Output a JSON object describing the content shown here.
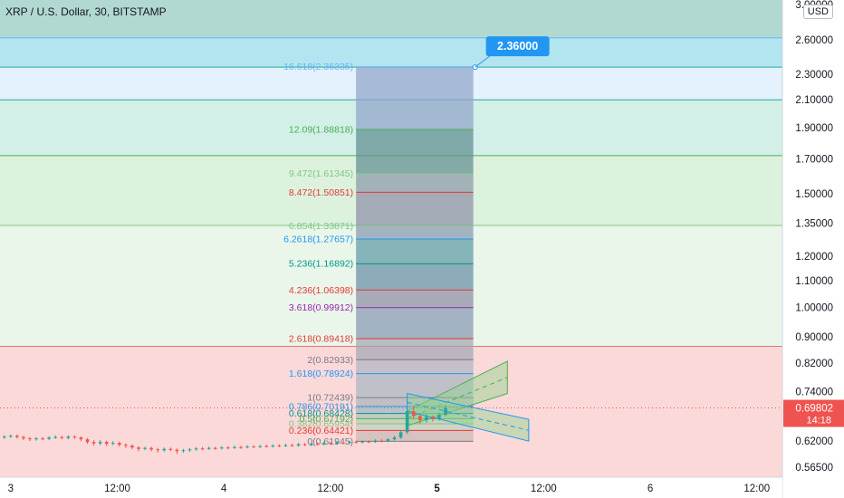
{
  "header": {
    "title": "XRP / U.S. Dollar, 30, BITSTAMP",
    "currency_badge": "USD"
  },
  "chart_data": {
    "type": "candlestick",
    "price_axis": {
      "scale": "log",
      "range": [
        0.545,
        3.0
      ],
      "ticks": [
        "2.60000",
        "2.30000",
        "2.10000",
        "1.90000",
        "1.70000",
        "1.50000",
        "1.35000",
        "1.20000",
        "1.10000",
        "1.00000",
        "0.90000",
        "0.82000",
        "0.74000",
        "0.62000",
        "0.56500"
      ],
      "top_tick": "3.00000"
    },
    "time_axis": {
      "ticks": [
        {
          "label": "3",
          "day": 3.0
        },
        {
          "label": "12:00",
          "day": 3.5
        },
        {
          "label": "4",
          "day": 4.0
        },
        {
          "label": "12:00",
          "day": 4.5
        },
        {
          "label": "5",
          "day": 5.0
        },
        {
          "label": "12:00",
          "day": 5.5
        },
        {
          "label": "6",
          "day": 6.0
        },
        {
          "label": "12:00",
          "day": 6.5
        }
      ],
      "range_days": [
        2.95,
        6.62
      ]
    },
    "current_price": {
      "value": "0.69802",
      "countdown": "14:18",
      "price": 0.69802
    },
    "target_callout": {
      "label": "2.36000",
      "price": 2.36
    },
    "fib_extension": {
      "start_day": 4.62,
      "end_day": 5.17,
      "levels": [
        {
          "ratio": "16.618",
          "price": 2.36335,
          "label": "16.618(2.36335)",
          "color": "#64b5f6"
        },
        {
          "ratio": "12.09",
          "price": 1.88818,
          "label": "12.09(1.88818)",
          "color": "#4caf50"
        },
        {
          "ratio": "9.472",
          "price": 1.61345,
          "label": "9.472(1.61345)",
          "color": "#81c784"
        },
        {
          "ratio": "8.472",
          "price": 1.50851,
          "label": "8.472(1.50851)",
          "color": "#e53935"
        },
        {
          "ratio": "6.854",
          "price": 1.33871,
          "label": "6.854(1.33871)",
          "color": "#81c784"
        },
        {
          "ratio": "6.2618",
          "price": 1.27657,
          "label": "6.2618(1.27657)",
          "color": "#2196f3"
        },
        {
          "ratio": "5.236",
          "price": 1.16892,
          "label": "5.236(1.16892)",
          "color": "#009688"
        },
        {
          "ratio": "4.236",
          "price": 1.06398,
          "label": "4.236(1.06398)",
          "color": "#e53935"
        },
        {
          "ratio": "3.618",
          "price": 0.99912,
          "label": "3.618(0.99912)",
          "color": "#9c27b0"
        },
        {
          "ratio": "2.618",
          "price": 0.89418,
          "label": "2.618(0.89418)",
          "color": "#e53935"
        },
        {
          "ratio": "2",
          "price": 0.82933,
          "label": "2(0.82933)",
          "color": "#787b86"
        },
        {
          "ratio": "1.618",
          "price": 0.78924,
          "label": "1.618(0.78924)",
          "color": "#2196f3"
        },
        {
          "ratio": "1",
          "price": 0.72439,
          "label": "1(0.72439)",
          "color": "#787b86"
        },
        {
          "ratio": "0.786",
          "price": 0.70191,
          "label": "0.786(0.70191)",
          "color": "#2196f3"
        },
        {
          "ratio": "0.618",
          "price": 0.68428,
          "label": "0.618(0.68428)",
          "color": "#009688"
        },
        {
          "ratio": "0.5",
          "price": 0.67192,
          "label": "0.5(0.67192)",
          "color": "#4caf50"
        },
        {
          "ratio": "0.382",
          "price": 0.65954,
          "label": "0.382(0.65954)",
          "color": "#81c784"
        },
        {
          "ratio": "0.236",
          "price": 0.64421,
          "label": "0.236(0.64421)",
          "color": "#e53935"
        },
        {
          "ratio": "0",
          "price": 0.61945,
          "label": "0(0.61945)",
          "color": "#787b86"
        }
      ]
    },
    "zones": [
      {
        "from": 2.62,
        "to": 3.0,
        "color": "#b2d8d2"
      },
      {
        "from": 2.36,
        "to": 2.62,
        "color": "#b3e5f0"
      },
      {
        "from": 2.1,
        "to": 2.36,
        "color": "#e3f2fd"
      },
      {
        "from": 1.72,
        "to": 2.1,
        "color": "#d2f0e8"
      },
      {
        "from": 1.34,
        "to": 1.72,
        "color": "#ddf2dd"
      },
      {
        "from": 0.87,
        "to": 1.34,
        "color": "#eaf6ea"
      },
      {
        "from": 0.545,
        "to": 0.87,
        "color": "#fbd9d9"
      }
    ],
    "zone_lines": [
      {
        "price": 2.62,
        "color": "#64b5f6"
      },
      {
        "price": 2.36,
        "color": "#26a69a"
      },
      {
        "price": 2.1,
        "color": "#26a69a"
      },
      {
        "price": 1.72,
        "color": "#4caf50"
      },
      {
        "price": 1.34,
        "color": "#81c784"
      },
      {
        "price": 0.87,
        "color": "#e57373"
      }
    ],
    "channels": [
      {
        "from_day": 4.86,
        "to_day": 5.33,
        "lower": [
          0.655,
          0.735
        ],
        "upper": [
          0.69,
          0.825
        ],
        "color": "#4caf50"
      },
      {
        "from_day": 4.86,
        "to_day": 5.43,
        "lower": [
          0.69,
          0.62
        ],
        "upper": [
          0.735,
          0.67
        ],
        "color": "#2196f3"
      }
    ],
    "series": [
      {
        "day": 2.97,
        "open": 0.628,
        "close": 0.63,
        "high": 0.633,
        "low": 0.625
      },
      {
        "day": 3.0,
        "open": 0.63,
        "close": 0.632,
        "high": 0.635,
        "low": 0.627
      },
      {
        "day": 3.03,
        "open": 0.632,
        "close": 0.629,
        "high": 0.635,
        "low": 0.626
      },
      {
        "day": 3.06,
        "open": 0.629,
        "close": 0.626,
        "high": 0.632,
        "low": 0.622
      },
      {
        "day": 3.09,
        "open": 0.626,
        "close": 0.624,
        "high": 0.629,
        "low": 0.62
      },
      {
        "day": 3.12,
        "open": 0.624,
        "close": 0.626,
        "high": 0.629,
        "low": 0.621
      },
      {
        "day": 3.15,
        "open": 0.626,
        "close": 0.625,
        "high": 0.629,
        "low": 0.622
      },
      {
        "day": 3.18,
        "open": 0.625,
        "close": 0.628,
        "high": 0.631,
        "low": 0.622
      },
      {
        "day": 3.21,
        "open": 0.628,
        "close": 0.629,
        "high": 0.633,
        "low": 0.625
      },
      {
        "day": 3.24,
        "open": 0.629,
        "close": 0.627,
        "high": 0.632,
        "low": 0.624
      },
      {
        "day": 3.27,
        "open": 0.627,
        "close": 0.63,
        "high": 0.633,
        "low": 0.624
      },
      {
        "day": 3.3,
        "open": 0.63,
        "close": 0.628,
        "high": 0.633,
        "low": 0.625
      },
      {
        "day": 3.33,
        "open": 0.628,
        "close": 0.624,
        "high": 0.631,
        "low": 0.62
      },
      {
        "day": 3.36,
        "open": 0.624,
        "close": 0.618,
        "high": 0.627,
        "low": 0.614
      },
      {
        "day": 3.39,
        "open": 0.618,
        "close": 0.615,
        "high": 0.622,
        "low": 0.61
      },
      {
        "day": 3.42,
        "open": 0.615,
        "close": 0.618,
        "high": 0.622,
        "low": 0.611
      },
      {
        "day": 3.45,
        "open": 0.618,
        "close": 0.614,
        "high": 0.621,
        "low": 0.609
      },
      {
        "day": 3.48,
        "open": 0.614,
        "close": 0.616,
        "high": 0.62,
        "low": 0.611
      },
      {
        "day": 3.51,
        "open": 0.616,
        "close": 0.612,
        "high": 0.619,
        "low": 0.608
      },
      {
        "day": 3.54,
        "open": 0.612,
        "close": 0.61,
        "high": 0.615,
        "low": 0.605
      },
      {
        "day": 3.57,
        "open": 0.61,
        "close": 0.606,
        "high": 0.613,
        "low": 0.602
      },
      {
        "day": 3.6,
        "open": 0.606,
        "close": 0.603,
        "high": 0.609,
        "low": 0.598
      },
      {
        "day": 3.63,
        "open": 0.603,
        "close": 0.605,
        "high": 0.608,
        "low": 0.6
      },
      {
        "day": 3.66,
        "open": 0.605,
        "close": 0.602,
        "high": 0.608,
        "low": 0.598
      },
      {
        "day": 3.69,
        "open": 0.602,
        "close": 0.6,
        "high": 0.605,
        "low": 0.595
      },
      {
        "day": 3.72,
        "open": 0.6,
        "close": 0.603,
        "high": 0.606,
        "low": 0.597
      },
      {
        "day": 3.75,
        "open": 0.603,
        "close": 0.601,
        "high": 0.606,
        "low": 0.598
      },
      {
        "day": 3.78,
        "open": 0.601,
        "close": 0.598,
        "high": 0.604,
        "low": 0.592
      },
      {
        "day": 3.81,
        "open": 0.598,
        "close": 0.6,
        "high": 0.603,
        "low": 0.595
      },
      {
        "day": 3.84,
        "open": 0.6,
        "close": 0.602,
        "high": 0.605,
        "low": 0.597
      },
      {
        "day": 3.87,
        "open": 0.602,
        "close": 0.604,
        "high": 0.607,
        "low": 0.599
      },
      {
        "day": 3.9,
        "open": 0.604,
        "close": 0.603,
        "high": 0.607,
        "low": 0.6
      },
      {
        "day": 3.93,
        "open": 0.603,
        "close": 0.605,
        "high": 0.608,
        "low": 0.601
      },
      {
        "day": 3.96,
        "open": 0.605,
        "close": 0.604,
        "high": 0.608,
        "low": 0.601
      },
      {
        "day": 3.99,
        "open": 0.604,
        "close": 0.606,
        "high": 0.609,
        "low": 0.602
      },
      {
        "day": 4.02,
        "open": 0.606,
        "close": 0.605,
        "high": 0.609,
        "low": 0.602
      },
      {
        "day": 4.05,
        "open": 0.605,
        "close": 0.607,
        "high": 0.61,
        "low": 0.603
      },
      {
        "day": 4.08,
        "open": 0.607,
        "close": 0.606,
        "high": 0.61,
        "low": 0.603
      },
      {
        "day": 4.11,
        "open": 0.606,
        "close": 0.608,
        "high": 0.611,
        "low": 0.604
      },
      {
        "day": 4.14,
        "open": 0.608,
        "close": 0.607,
        "high": 0.611,
        "low": 0.605
      },
      {
        "day": 4.17,
        "open": 0.607,
        "close": 0.609,
        "high": 0.612,
        "low": 0.605
      },
      {
        "day": 4.2,
        "open": 0.609,
        "close": 0.608,
        "high": 0.612,
        "low": 0.606
      },
      {
        "day": 4.23,
        "open": 0.608,
        "close": 0.61,
        "high": 0.613,
        "low": 0.606
      },
      {
        "day": 4.26,
        "open": 0.61,
        "close": 0.609,
        "high": 0.613,
        "low": 0.607
      },
      {
        "day": 4.29,
        "open": 0.609,
        "close": 0.611,
        "high": 0.614,
        "low": 0.607
      },
      {
        "day": 4.32,
        "open": 0.611,
        "close": 0.61,
        "high": 0.614,
        "low": 0.608
      },
      {
        "day": 4.35,
        "open": 0.61,
        "close": 0.613,
        "high": 0.616,
        "low": 0.608
      },
      {
        "day": 4.38,
        "open": 0.613,
        "close": 0.611,
        "high": 0.616,
        "low": 0.609
      },
      {
        "day": 4.41,
        "open": 0.611,
        "close": 0.614,
        "high": 0.617,
        "low": 0.609
      },
      {
        "day": 4.44,
        "open": 0.614,
        "close": 0.613,
        "high": 0.617,
        "low": 0.61
      },
      {
        "day": 4.47,
        "open": 0.613,
        "close": 0.616,
        "high": 0.619,
        "low": 0.611
      },
      {
        "day": 4.5,
        "open": 0.616,
        "close": 0.614,
        "high": 0.619,
        "low": 0.612
      },
      {
        "day": 4.53,
        "open": 0.614,
        "close": 0.617,
        "high": 0.62,
        "low": 0.612
      },
      {
        "day": 4.56,
        "open": 0.617,
        "close": 0.616,
        "high": 0.62,
        "low": 0.613
      },
      {
        "day": 4.59,
        "open": 0.616,
        "close": 0.618,
        "high": 0.621,
        "low": 0.614
      },
      {
        "day": 4.62,
        "open": 0.618,
        "close": 0.617,
        "high": 0.621,
        "low": 0.615
      },
      {
        "day": 4.65,
        "open": 0.617,
        "close": 0.619,
        "high": 0.622,
        "low": 0.615
      },
      {
        "day": 4.68,
        "open": 0.619,
        "close": 0.618,
        "high": 0.622,
        "low": 0.616
      },
      {
        "day": 4.71,
        "open": 0.618,
        "close": 0.621,
        "high": 0.624,
        "low": 0.616
      },
      {
        "day": 4.74,
        "open": 0.621,
        "close": 0.62,
        "high": 0.624,
        "low": 0.617
      },
      {
        "day": 4.77,
        "open": 0.62,
        "close": 0.624,
        "high": 0.627,
        "low": 0.618
      },
      {
        "day": 4.8,
        "open": 0.624,
        "close": 0.628,
        "high": 0.632,
        "low": 0.621
      },
      {
        "day": 4.83,
        "open": 0.628,
        "close": 0.64,
        "high": 0.645,
        "low": 0.625
      },
      {
        "day": 4.86,
        "open": 0.64,
        "close": 0.69,
        "high": 0.698,
        "low": 0.636
      },
      {
        "day": 4.89,
        "open": 0.69,
        "close": 0.678,
        "high": 0.702,
        "low": 0.67
      },
      {
        "day": 4.92,
        "open": 0.678,
        "close": 0.668,
        "high": 0.684,
        "low": 0.66
      },
      {
        "day": 4.95,
        "open": 0.668,
        "close": 0.676,
        "high": 0.682,
        "low": 0.662
      },
      {
        "day": 4.98,
        "open": 0.676,
        "close": 0.671,
        "high": 0.68,
        "low": 0.665
      },
      {
        "day": 5.01,
        "open": 0.671,
        "close": 0.681,
        "high": 0.686,
        "low": 0.667
      },
      {
        "day": 5.04,
        "open": 0.681,
        "close": 0.698,
        "high": 0.705,
        "low": 0.678
      }
    ]
  }
}
